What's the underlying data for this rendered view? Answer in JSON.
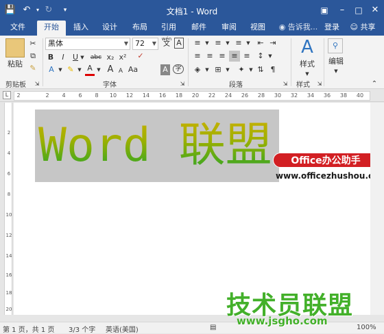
{
  "window": {
    "title": "文档1 - Word"
  },
  "tabs": [
    {
      "label": "文件"
    },
    {
      "label": "开始"
    },
    {
      "label": "插入"
    },
    {
      "label": "设计"
    },
    {
      "label": "布局"
    },
    {
      "label": "引用"
    },
    {
      "label": "邮件"
    },
    {
      "label": "审阅"
    },
    {
      "label": "视图"
    }
  ],
  "tellme": {
    "placeholder": "告诉我..."
  },
  "account": {
    "login_label": "登录",
    "share_label": "共享"
  },
  "ribbon": {
    "clipboard": {
      "paste_label": "粘贴",
      "group_label": "剪贴板"
    },
    "font": {
      "family": "黑体",
      "size": "72",
      "group_label": "字体",
      "wen_label": "wén",
      "wen_char": "文",
      "a_box": "A"
    },
    "paragraph": {
      "group_label": "段落"
    },
    "styles": {
      "styles_label": "样式",
      "group_label": "样式"
    },
    "editing": {
      "editing_label": "编辑"
    }
  },
  "ruler": {
    "marks": [
      "2",
      "2",
      "4",
      "6",
      "8",
      "10",
      "12",
      "14",
      "16",
      "18",
      "20",
      "22",
      "24",
      "26",
      "28",
      "30",
      "32",
      "34",
      "36",
      "38",
      "40"
    ]
  },
  "vruler": {
    "marks": [
      "2",
      "4",
      "6",
      "8",
      "10",
      "12",
      "14",
      "16",
      "18",
      "20"
    ]
  },
  "document": {
    "wordart_latin": "Word ",
    "wordart_cjk": "联盟"
  },
  "overlay": {
    "badge_text": "Office办公助手",
    "badge_url": "www.officezhushou.com",
    "watermark_text": "技术员联盟",
    "watermark_url": "www.jsgho.com"
  },
  "status": {
    "page": "第 1 页，共 1 页",
    "words": "3/3 个字",
    "language": "英语(美国)",
    "zoom": "100%"
  },
  "colors": {
    "accent": "#2b579a",
    "wordart_top": "#c8b000",
    "wordart_bottom": "#3aa32d",
    "badge_red": "#d21f23",
    "watermark_green": "#43b02a"
  }
}
